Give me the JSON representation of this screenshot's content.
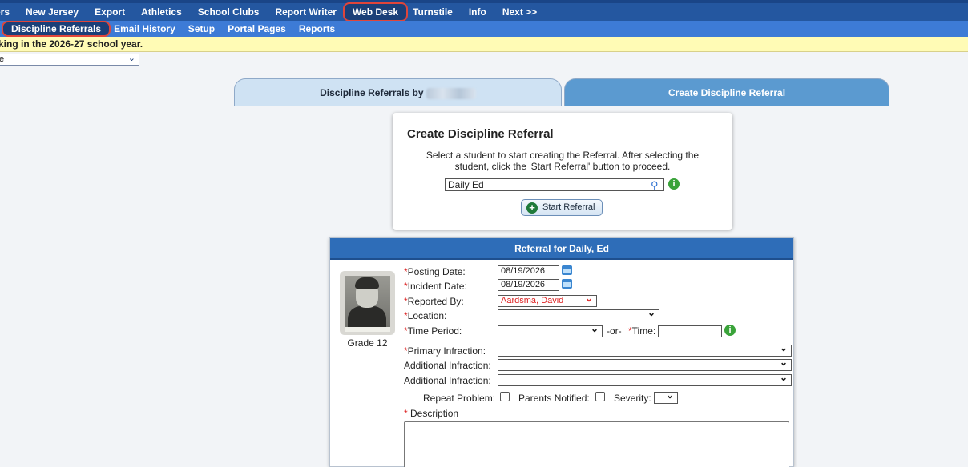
{
  "topnav": {
    "items": [
      "ers",
      "New Jersey",
      "Export",
      "Athletics",
      "School Clubs",
      "Report Writer",
      "Web Desk",
      "Turnstile",
      "Info",
      "Next >>"
    ]
  },
  "subnav": {
    "items": [
      "Discipline Referrals",
      "Email History",
      "Setup",
      "Portal Pages",
      "Reports"
    ]
  },
  "notice": "king in the 2026-27 school year.",
  "topselect": {
    "value": "e"
  },
  "tabs": {
    "left_label": "Discipline Referrals by",
    "right_label": "Create Discipline Referral"
  },
  "create_card": {
    "title": "Create Discipline Referral",
    "instructions": "Select a student to start creating the Referral. After selecting the student, click the 'Start Referral' button to proceed.",
    "student_value": "Daily Ed",
    "start_button": "Start Referral"
  },
  "referral": {
    "header": "Referral for Daily, Ed",
    "grade": "Grade 12",
    "posting_date_label": "Posting Date:",
    "posting_date": "08/19/2026",
    "incident_date_label": "Incident Date:",
    "incident_date": "08/19/2026",
    "reported_by_label": "Reported By:",
    "reported_by": "Aardsma, David",
    "location_label": "Location:",
    "location": "",
    "time_period_label": "Time Period:",
    "or_text": "-or-",
    "time_label": "Time:",
    "primary_infraction_label": "Primary Infraction:",
    "additional_infraction_label": "Additional Infraction:",
    "repeat_problem_label": "Repeat Problem:",
    "parents_notified_label": "Parents Notified:",
    "severity_label": "Severity:",
    "description_label": "Description",
    "required_mark": "*",
    "required_mark_spaced": "* "
  },
  "colors": {
    "nav_bg": "#2457a0",
    "subnav_bg": "#3d7bd6",
    "notice_bg": "#fffbb5",
    "highlight_border": "#e0453a",
    "panel_header": "#2e6db8"
  }
}
